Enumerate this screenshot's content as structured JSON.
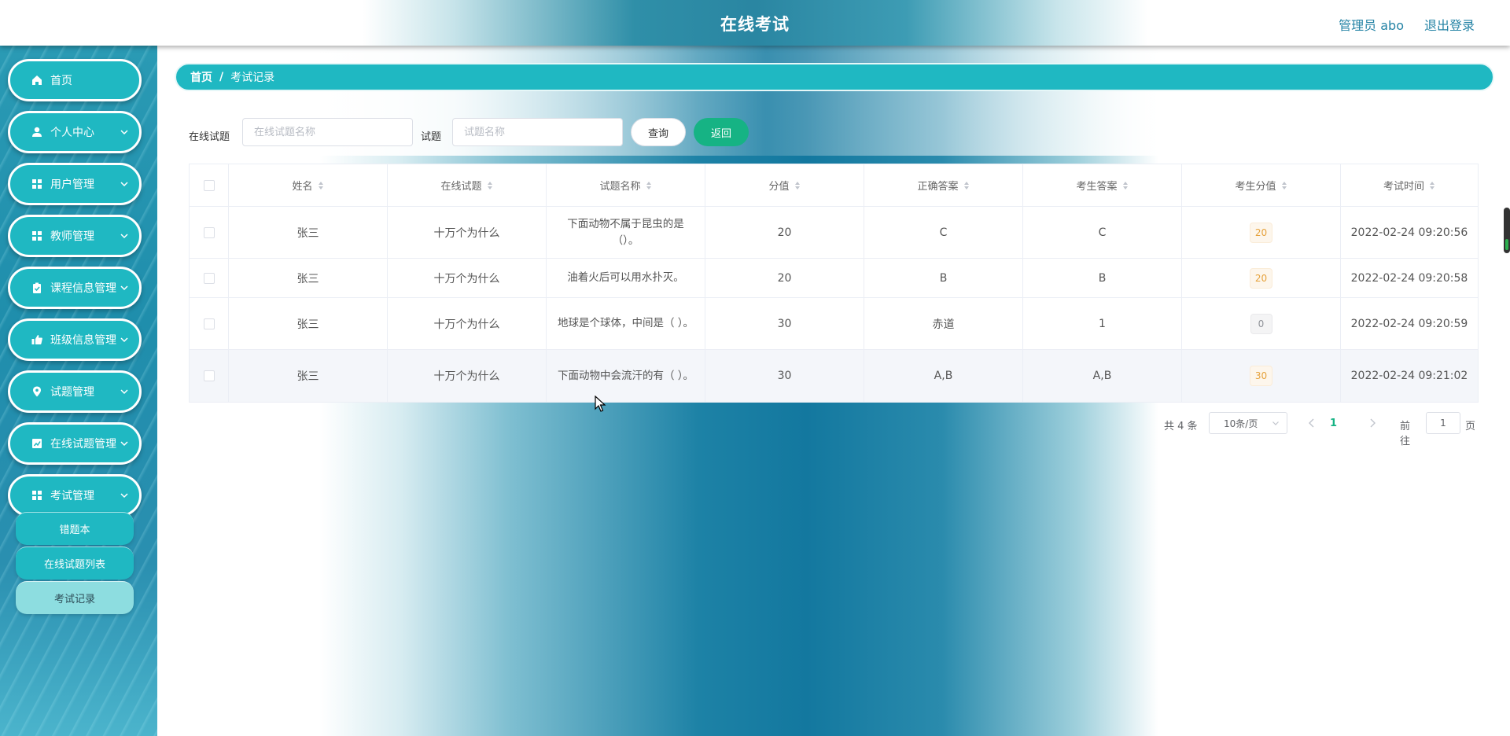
{
  "header": {
    "title": "在线考试",
    "user": "管理员 abo",
    "logout": "退出登录"
  },
  "sidebar": {
    "items": [
      {
        "label": "首页",
        "icon": "home-icon",
        "has_submenu": false
      },
      {
        "label": "个人中心",
        "icon": "user-icon",
        "has_submenu": true
      },
      {
        "label": "用户管理",
        "icon": "grid-icon",
        "has_submenu": true
      },
      {
        "label": "教师管理",
        "icon": "grid-icon",
        "has_submenu": true
      },
      {
        "label": "课程信息管理",
        "icon": "clipboard-icon",
        "has_submenu": true
      },
      {
        "label": "班级信息管理",
        "icon": "thumb-icon",
        "has_submenu": true
      },
      {
        "label": "试题管理",
        "icon": "pin-icon",
        "has_submenu": true
      },
      {
        "label": "在线试题管理",
        "icon": "chart-icon",
        "has_submenu": true
      },
      {
        "label": "考试管理",
        "icon": "grid-icon",
        "has_submenu": true
      }
    ],
    "submenu": [
      {
        "label": "错题本",
        "active": false
      },
      {
        "label": "在线试题列表",
        "active": false
      },
      {
        "label": "考试记录",
        "active": true
      }
    ]
  },
  "breadcrumb": {
    "home": "首页",
    "separator": "/",
    "current": "考试记录"
  },
  "search": {
    "paper_label": "在线试题",
    "paper_placeholder": "在线试题名称",
    "question_label": "试题",
    "question_placeholder": "试题名称",
    "query_button": "查询",
    "back_button": "返回"
  },
  "table": {
    "columns": [
      "姓名",
      "在线试题",
      "试题名称",
      "分值",
      "正确答案",
      "考生答案",
      "考生分值",
      "考试时间"
    ],
    "rows": [
      {
        "name": "张三",
        "paper": "十万个为什么",
        "question": "下面动物不属于昆虫的是（）。",
        "points": "20",
        "correct": "C",
        "answer": "C",
        "score": "20",
        "time": "2022-02-24 09:20:56"
      },
      {
        "name": "张三",
        "paper": "十万个为什么",
        "question": "油着火后可以用水扑灭。",
        "points": "20",
        "correct": "B",
        "answer": "B",
        "score": "20",
        "time": "2022-02-24 09:20:58"
      },
      {
        "name": "张三",
        "paper": "十万个为什么",
        "question": "地球是个球体，中间是（ ）。",
        "points": "30",
        "correct": "赤道",
        "answer": "1",
        "score": "0",
        "time": "2022-02-24 09:20:59"
      },
      {
        "name": "张三",
        "paper": "十万个为什么",
        "question": "下面动物中会流汗的有（ ）。",
        "points": "30",
        "correct": "A,B",
        "answer": "A,B",
        "score": "30",
        "time": "2022-02-24 09:21:02"
      }
    ]
  },
  "pagination": {
    "total": "共 4 条",
    "page_size": "10条/页",
    "current_page": "1",
    "goto_label": "前往",
    "goto_value": "1",
    "page_unit": "页"
  },
  "colors": {
    "accent": "#1fb8c2",
    "back_button": "#16b384",
    "header_text": "#2483a5"
  }
}
